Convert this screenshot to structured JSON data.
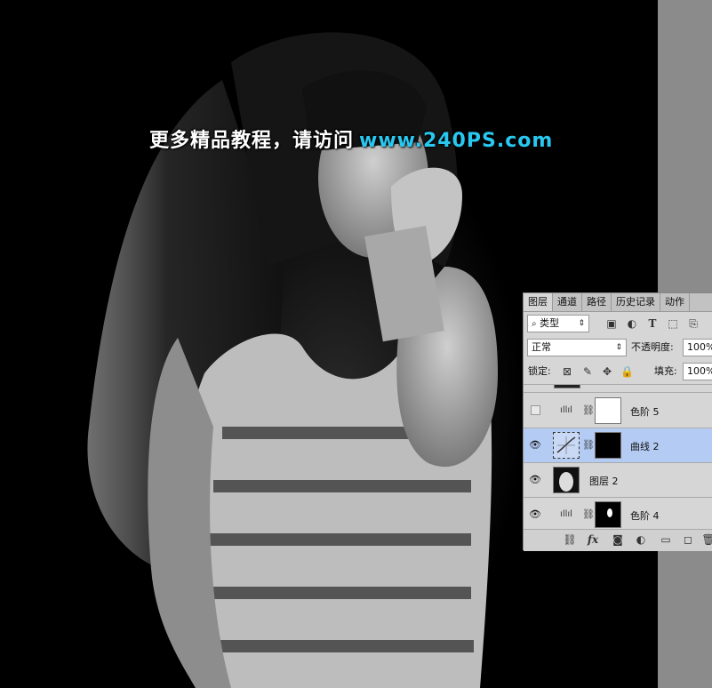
{
  "watermark": {
    "text": "更多精品教程，请访问",
    "url": "www.240PS.com"
  },
  "layers_panel": {
    "tabs": [
      {
        "label": "图层",
        "active": true
      },
      {
        "label": "通道",
        "active": false
      },
      {
        "label": "路径",
        "active": false
      },
      {
        "label": "历史记录",
        "active": false
      },
      {
        "label": "动作",
        "active": false
      }
    ],
    "filter_kind": "类型",
    "blend_mode": "正常",
    "opacity_label": "不透明度:",
    "opacity_value": "100%",
    "lock_label": "锁定:",
    "fill_label": "填充:",
    "fill_value": "100%",
    "layers": [
      {
        "name": "色阶 5",
        "type": "levels",
        "visible": false,
        "selected": false
      },
      {
        "name": "曲线 2",
        "type": "curves",
        "visible": true,
        "selected": true
      },
      {
        "name": "图层 2",
        "type": "pixel",
        "visible": true,
        "selected": false
      },
      {
        "name": "色阶 4",
        "type": "levels",
        "visible": true,
        "selected": false
      }
    ]
  },
  "icons": [
    "search-icon",
    "image-filter-icon",
    "adjustment-filter-icon",
    "type-filter-icon",
    "shape-filter-icon",
    "smart-filter-icon",
    "eye-icon",
    "chain-icon",
    "link-layers-icon",
    "fx-icon",
    "mask-icon",
    "adjustment-icon",
    "group-icon",
    "new-layer-icon",
    "delete-icon"
  ]
}
